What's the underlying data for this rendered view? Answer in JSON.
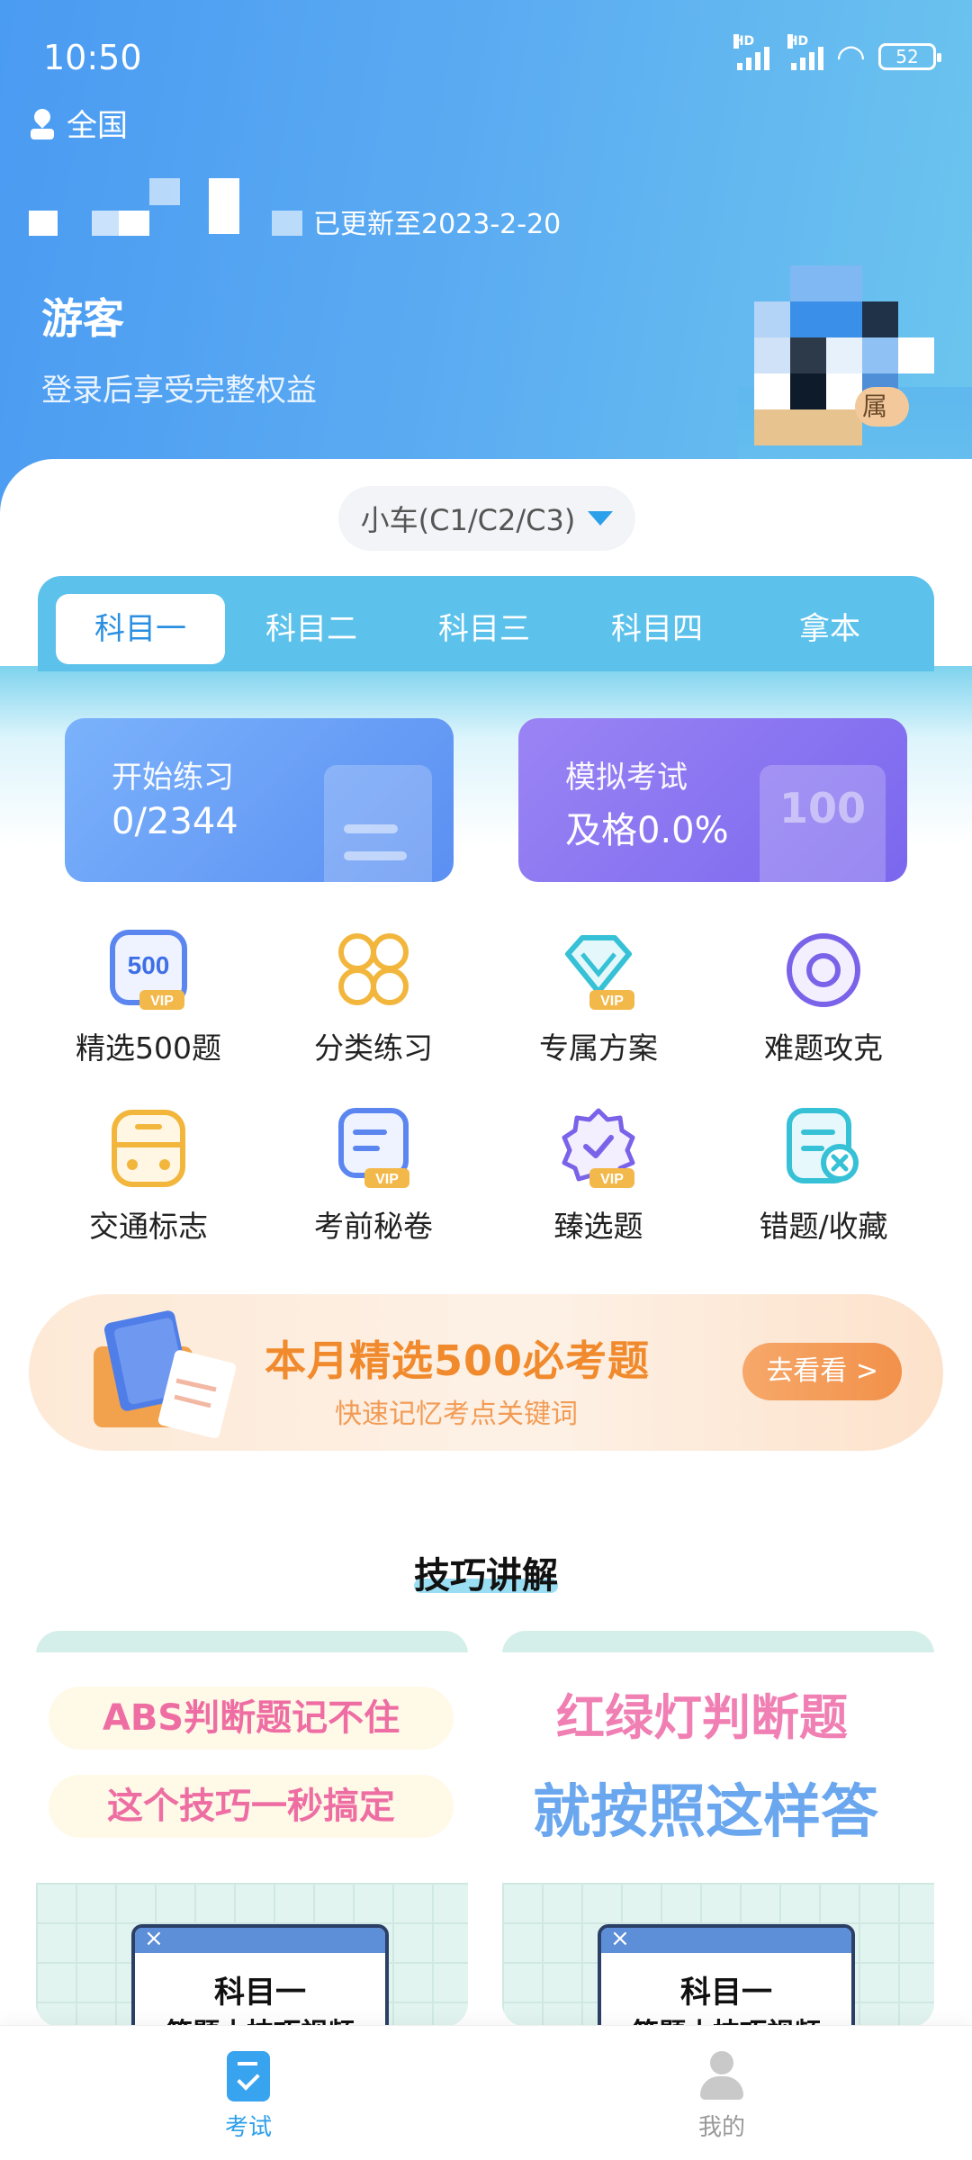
{
  "status_bar": {
    "time": "10:50",
    "battery": "52",
    "hd1": "HD",
    "hd2": "HD"
  },
  "location": {
    "label": "全国"
  },
  "header": {
    "update_text": "已更新至2023-2-20",
    "guest_name": "游客",
    "guest_sub": "登录后享受完整权益",
    "avatar_tag": "属"
  },
  "car_selector": {
    "label": "小车(C1/C2/C3)"
  },
  "tabs": [
    {
      "label": "科目一",
      "active": true
    },
    {
      "label": "科目二",
      "active": false
    },
    {
      "label": "科目三",
      "active": false
    },
    {
      "label": "科目四",
      "active": false
    },
    {
      "label": "拿本",
      "active": false
    }
  ],
  "cards": {
    "practice": {
      "label": "开始练习",
      "value": "0/2344"
    },
    "exam": {
      "label": "模拟考试",
      "value": "及格0.0%",
      "icon_text": "100"
    }
  },
  "features": [
    {
      "label": "精选500题",
      "icon": "500-vip-icon",
      "badge": "500",
      "vip": "VIP"
    },
    {
      "label": "分类练习",
      "icon": "category-grid-icon"
    },
    {
      "label": "专属方案",
      "icon": "diamond-vip-icon",
      "vip": "VIP"
    },
    {
      "label": "难题攻克",
      "icon": "target-icon"
    },
    {
      "label": "交通标志",
      "icon": "bus-icon"
    },
    {
      "label": "考前秘卷",
      "icon": "secret-paper-vip-icon",
      "vip": "VIP"
    },
    {
      "label": "臻选题",
      "icon": "badge-check-vip-icon",
      "vip": "VIP"
    },
    {
      "label": "错题/收藏",
      "icon": "wrong-collection-icon"
    }
  ],
  "banner": {
    "title": "本月精选500必考题",
    "subtitle": "快速记忆考点关键词",
    "button": "去看看 >"
  },
  "tips": {
    "title": "技巧讲解",
    "cards": [
      {
        "line1": "ABS判断题记不住",
        "line2": "这个技巧一秒搞定",
        "window_title": "科目一",
        "window_sub": "答题小技巧视频"
      },
      {
        "line1": "红绿灯判断题",
        "line2": "就按照这样答",
        "window_title": "科目一",
        "window_sub": "答题小技巧视频"
      }
    ]
  },
  "bottom_nav": [
    {
      "label": "考试",
      "active": true
    },
    {
      "label": "我的",
      "active": false
    }
  ],
  "colors": {
    "primary": "#2f9fe8",
    "header_start": "#4a9bf2",
    "header_end": "#6cc6ee",
    "banner_accent": "#f08a2c",
    "tip_pink": "#ee6ea3",
    "tip_blue": "#6aa7ee"
  }
}
